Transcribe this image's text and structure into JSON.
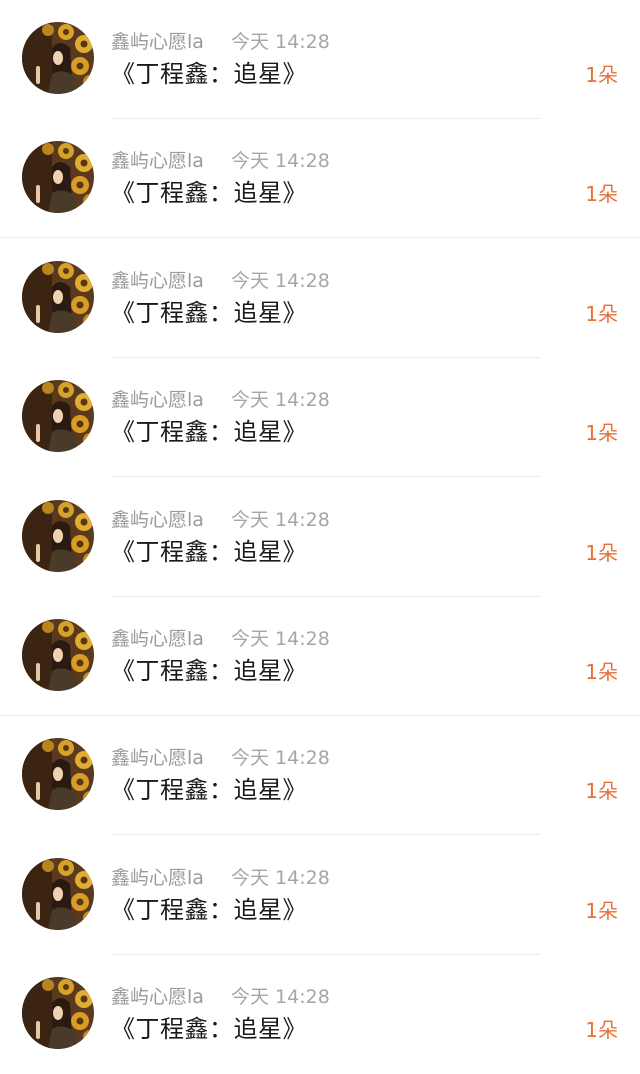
{
  "comments": [
    {
      "username": "鑫屿心愿la",
      "time": "今天 14:28",
      "message": "《丁程鑫：追星》",
      "flowers": "1朵",
      "divider": "inset"
    },
    {
      "username": "鑫屿心愿la",
      "time": "今天 14:28",
      "message": "《丁程鑫：追星》",
      "flowers": "1朵",
      "divider": "full"
    },
    {
      "username": "鑫屿心愿la",
      "time": "今天 14:28",
      "message": "《丁程鑫：追星》",
      "flowers": "1朵",
      "divider": "inset"
    },
    {
      "username": "鑫屿心愿la",
      "time": "今天 14:28",
      "message": "《丁程鑫：追星》",
      "flowers": "1朵",
      "divider": "inset"
    },
    {
      "username": "鑫屿心愿la",
      "time": "今天 14:28",
      "message": "《丁程鑫：追星》",
      "flowers": "1朵",
      "divider": "inset"
    },
    {
      "username": "鑫屿心愿la",
      "time": "今天 14:28",
      "message": "《丁程鑫：追星》",
      "flowers": "1朵",
      "divider": "full"
    },
    {
      "username": "鑫屿心愿la",
      "time": "今天 14:28",
      "message": "《丁程鑫：追星》",
      "flowers": "1朵",
      "divider": "inset"
    },
    {
      "username": "鑫屿心愿la",
      "time": "今天 14:28",
      "message": "《丁程鑫：追星》",
      "flowers": "1朵",
      "divider": "inset"
    },
    {
      "username": "鑫屿心愿la",
      "time": "今天 14:28",
      "message": "《丁程鑫：追星》",
      "flowers": "1朵",
      "divider": "none"
    }
  ],
  "colors": {
    "flower_accent": "#e8703a",
    "username_gray": "#9a9a9a",
    "message_text": "#1a1a1a"
  },
  "icons": {
    "avatar": "avatar-sunflower-photo"
  }
}
